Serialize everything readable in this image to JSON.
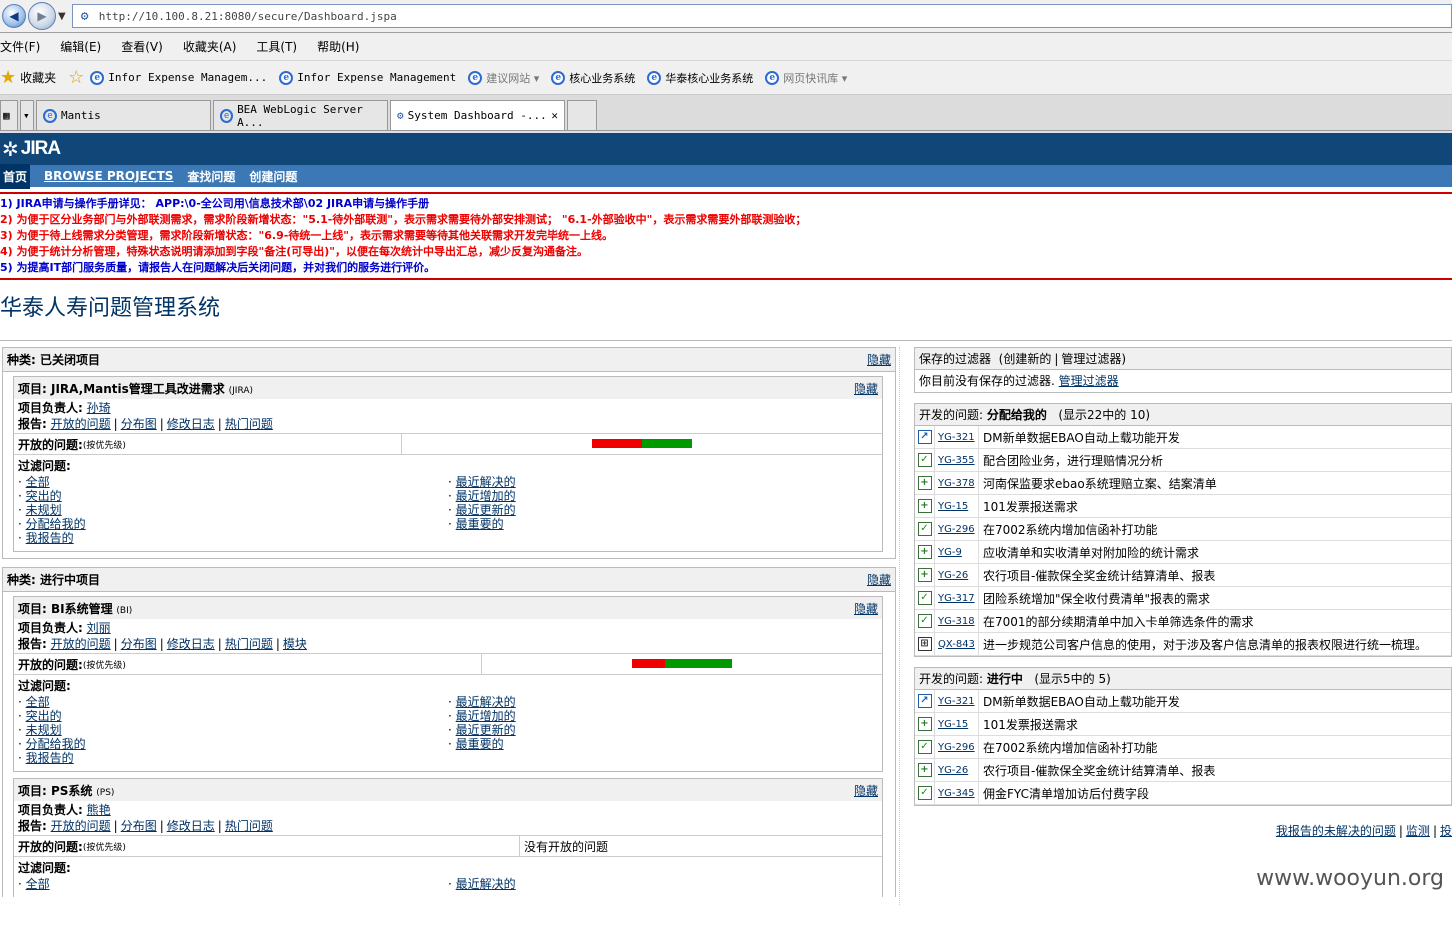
{
  "browser": {
    "address": "http://10.100.8.21:8080/secure/Dashboard.jspa",
    "menu": [
      "文件(F)",
      "编辑(E)",
      "查看(V)",
      "收藏夹(A)",
      "工具(T)",
      "帮助(H)"
    ],
    "favorites_label": "收藏夹",
    "favorites": [
      "Infor Expense Managem...",
      "Infor Expense Management",
      "建议网站 ▾",
      "核心业务系统",
      "华泰核心业务系统",
      "网页快讯库 ▾"
    ],
    "tabs": [
      "Mantis",
      "BEA WebLogic Server A...",
      "System Dashboard -..."
    ]
  },
  "jira": {
    "logo": "JIRA",
    "nav": [
      "首页",
      "BROWSE PROJECTS",
      "查找问题",
      "创建问题"
    ],
    "announcements": [
      "1) JIRA申请与操作手册详见： APP:\\0-全公司用\\信息技术部\\02 JIRA申请与操作手册",
      "2) 为便于区分业务部门与外部联测需求，需求阶段新增状态：\"5.1-待外部联测\"，表示需求需要待外部安排测试； \"6.1-外部验收中\"，表示需求需要外部联测验收；",
      "3) 为便于待上线需求分类管理，需求阶段新增状态：\"6.9-待统一上线\"，表示需求需要等待其他关联需求开发完毕统一上线。",
      "4) 为便于统计分析管理，特殊状态说明请添加到字段\"备注(可导出)\"，以便在每次统计中导出汇总，减少反复沟通备注。",
      "5) 为提高IT部门服务质量，请报告人在问题解决后关闭问题，并对我们的服务进行评价。"
    ],
    "system_title": "华泰人寿问题管理系统"
  },
  "left": {
    "hide": "隐藏",
    "cat1": "种类: 已关闭项目",
    "cat2": "种类: 进行中项目",
    "lead_label": "项目负责人:",
    "report_label": "报告:",
    "open_label": "开放的问题:",
    "priority_note": "(按优先级)",
    "filter_label": "过滤问题:",
    "report_links": [
      "开放的问题",
      "分布图",
      "修改日志",
      "热门问题"
    ],
    "report_links_bi": [
      "开放的问题",
      "分布图",
      "修改日志",
      "热门问题",
      "模块"
    ],
    "filters_left": [
      "全部",
      "突出的",
      "未规划",
      "分配给我的",
      "我报告的"
    ],
    "filters_right": [
      "最近解决的",
      "最近增加的",
      "最近更新的",
      "最重要的"
    ],
    "p1_name": "项目: JIRA,Mantis管理工具改进需求",
    "p1_key": "(JIRA)",
    "p1_lead": "孙琦",
    "p2_name": "项目: BI系统管理",
    "p2_key": "(BI)",
    "p2_lead": "刘丽",
    "p3_name": "项目: PS系统",
    "p3_key": "(PS)",
    "p3_lead": "熊艳",
    "no_open": "没有开放的问题",
    "bars": [
      {
        "red": 0.5,
        "green": 0.5
      },
      {
        "red": 0.33,
        "green": 0.67
      }
    ]
  },
  "right": {
    "filters_title": "保存的过滤器",
    "filters_create": "(创建新的",
    "filters_manage": "管理过滤器)",
    "no_saved": "你目前没有保存的过滤器.",
    "manage_link": "管理过滤器",
    "assigned_label": "开发的问题:",
    "assigned_title": "分配给我的",
    "assigned_count": "(显示22中的  10)",
    "inprog_title": "进行中",
    "inprog_count": "(显示5中的  5)",
    "assigned": [
      {
        "icon": "imp",
        "key": "YG-321",
        "summary": "DM新单数据EBAO自动上载功能开发"
      },
      {
        "icon": "task",
        "key": "YG-355",
        "summary": "配合团险业务，进行理赔情况分析"
      },
      {
        "icon": "new",
        "key": "YG-378",
        "summary": "河南保监要求ebao系统理赔立案、结案清单"
      },
      {
        "icon": "new",
        "key": "YG-15",
        "summary": "101发票报送需求"
      },
      {
        "icon": "task",
        "key": "YG-296",
        "summary": "在7002系统内增加信函补打功能"
      },
      {
        "icon": "new",
        "key": "YG-9",
        "summary": "应收清单和实收清单对附加险的统计需求"
      },
      {
        "icon": "new",
        "key": "YG-26",
        "summary": "农行项目-催款保全奖金统计结算清单、报表"
      },
      {
        "icon": "task",
        "key": "YG-317",
        "summary": "团险系统增加\"保全收付费清单\"报表的需求"
      },
      {
        "icon": "task",
        "key": "YG-318",
        "summary": "在7001的部分续期清单中加入卡单筛选条件的需求"
      },
      {
        "icon": "sub",
        "key": "QX-843",
        "summary": "进一步规范公司客户信息的使用，对于涉及客户信息清单的报表权限进行统一梳理。"
      }
    ],
    "inprogress": [
      {
        "icon": "imp",
        "key": "YG-321",
        "summary": "DM新单数据EBAO自动上载功能开发"
      },
      {
        "icon": "new",
        "key": "YG-15",
        "summary": "101发票报送需求"
      },
      {
        "icon": "task",
        "key": "YG-296",
        "summary": "在7002系统内增加信函补打功能"
      },
      {
        "icon": "new",
        "key": "YG-26",
        "summary": "农行项目-催款保全奖金统计结算清单、报表"
      },
      {
        "icon": "task",
        "key": "YG-345",
        "summary": "佣金FYC清单增加访后付费字段"
      }
    ],
    "footer": [
      "我报告的未解决的问题",
      "监测",
      "投"
    ]
  },
  "watermark": "www.wooyun.org"
}
